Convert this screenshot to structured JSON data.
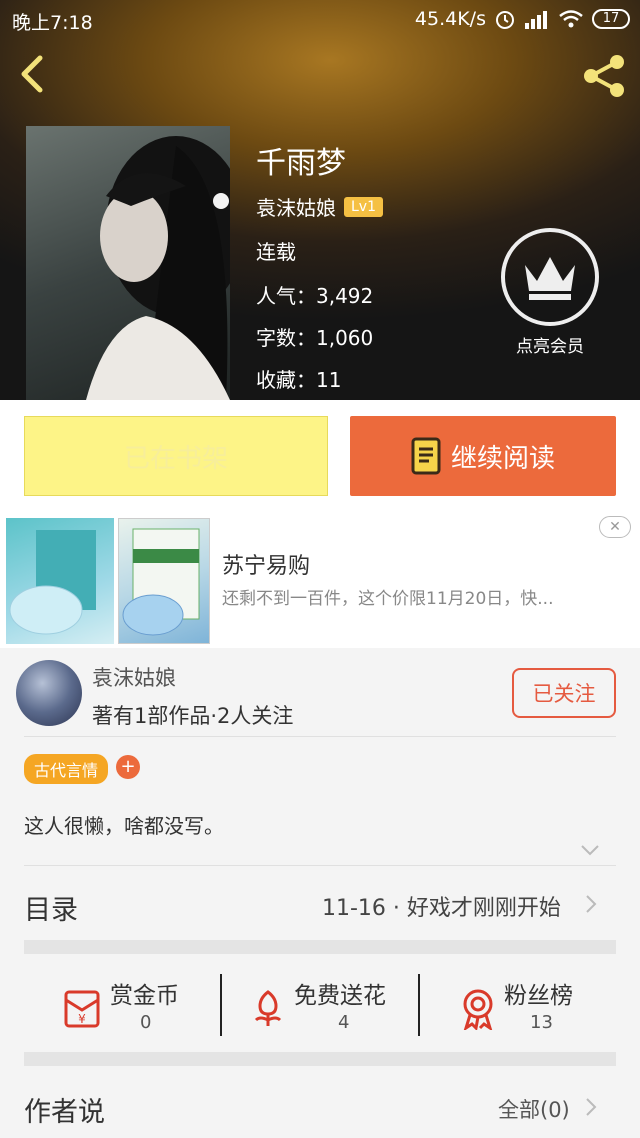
{
  "status_bar": {
    "time": "晚上7:18",
    "net_speed": "45.4K/s",
    "battery": "17"
  },
  "book": {
    "title": "千雨梦",
    "author": "袁沫姑娘",
    "author_level": "Lv1",
    "status": "连载",
    "popularity": "人气：3,492",
    "word_count": "字数：1,060",
    "favorites": "收藏：11"
  },
  "vip": {
    "label": "点亮会员"
  },
  "actions": {
    "shelf_label": "已在书架",
    "read_label": "继续阅读"
  },
  "ad": {
    "title": "苏宁易购",
    "desc": "还剩不到一百件，这个价限11月20日，快...",
    "close": "✕"
  },
  "author_card": {
    "name": "袁沫姑娘",
    "meta": "著有1部作品·2人关注",
    "follow_label": "已关注",
    "tag": "古代言情",
    "tag_add": "+",
    "bio": "这人很懒，啥都没写。"
  },
  "toc": {
    "label": "目录",
    "latest": "11-16 · 好戏才刚刚开始"
  },
  "stats": [
    {
      "label": "赏金币",
      "value": "0"
    },
    {
      "label": "免费送花",
      "value": "4"
    },
    {
      "label": "粉丝榜",
      "value": "13"
    }
  ],
  "author_said": {
    "label": "作者说",
    "all": "全部(0)"
  },
  "colors": {
    "accent": "#ec6a3c",
    "follow": "#e55a40",
    "shelf_bg": "#fdf487",
    "tag": "#f5a623",
    "icon_red": "#d93a2a"
  }
}
